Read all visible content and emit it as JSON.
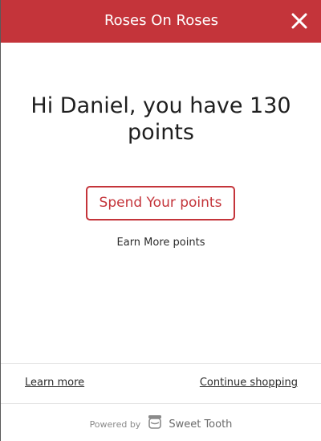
{
  "header": {
    "title": "Roses On Roses",
    "background_color": "#c4343a",
    "close_icon": "close-x"
  },
  "main": {
    "greeting": "Hi Daniel, you have 130 points",
    "spend_button_label": "Spend Your points",
    "earn_link_label": "Earn More points",
    "accent_color": "#c4343a"
  },
  "footer": {
    "learn_more_label": "Learn more",
    "continue_shopping_label": "Continue shopping",
    "powered_by_label": "Powered by",
    "brand_name": "Sweet Tooth",
    "brand_icon": "sweet-tooth-jar"
  }
}
